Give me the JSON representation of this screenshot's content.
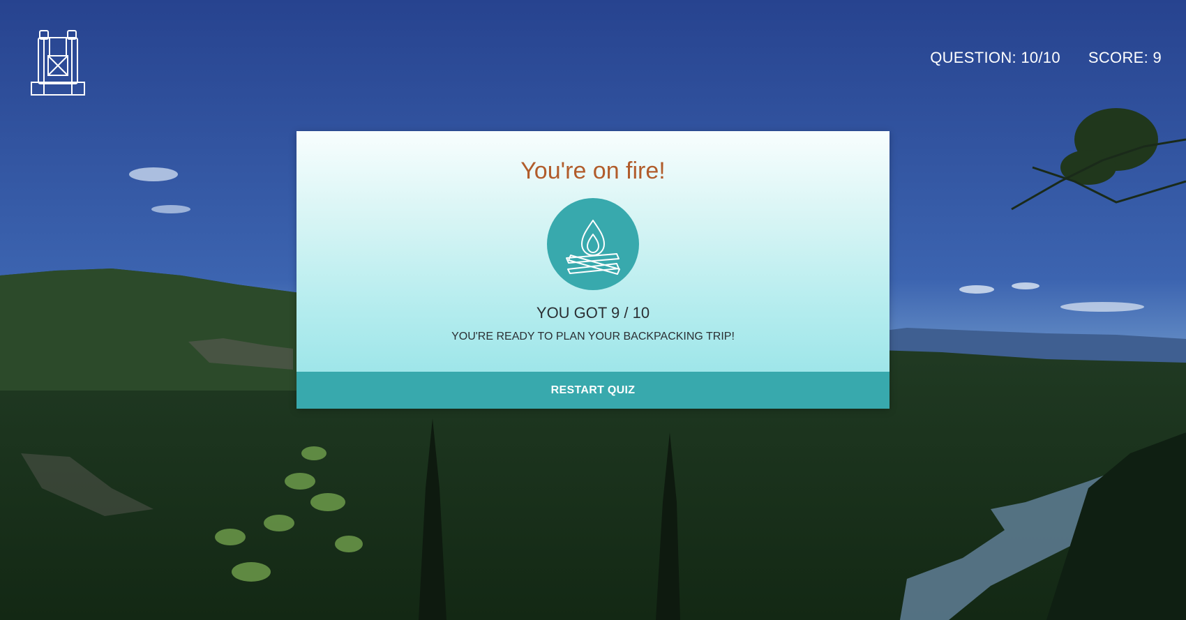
{
  "header": {
    "logo_icon": "backpack-icon",
    "question_label": "QUESTION: 10/10",
    "score_label": "SCORE: 9"
  },
  "result": {
    "title": "You're on fire!",
    "icon": "campfire-icon",
    "score_line": "YOU GOT 9 / 10",
    "message": "YOU'RE READY TO PLAN YOUR BACKPACKING TRIP!",
    "restart_label": "RESTART QUIZ"
  },
  "colors": {
    "title": "#b15c2b",
    "accent": "#38a9ad",
    "text": "#2b2f33"
  }
}
